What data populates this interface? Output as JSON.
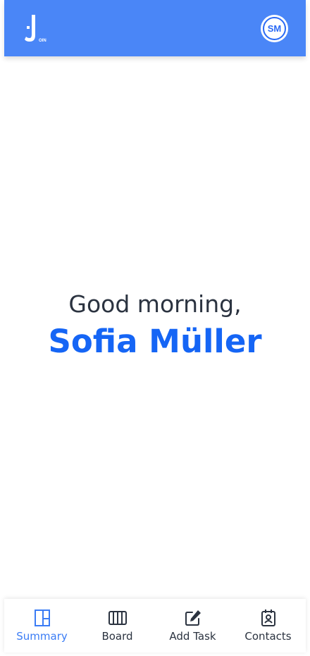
{
  "header": {
    "logo_icon": "join-logo-icon",
    "logo_subtext": "OIN",
    "avatar_initials": "SM"
  },
  "greeting": {
    "line": "Good morning,",
    "name": "Sofia Müller"
  },
  "nav": {
    "items": [
      {
        "label": "Summary",
        "icon": "summary-icon",
        "active": true
      },
      {
        "label": "Board",
        "icon": "board-icon",
        "active": false
      },
      {
        "label": "Add Task",
        "icon": "add-task-icon",
        "active": false
      },
      {
        "label": "Contacts",
        "icon": "contacts-icon",
        "active": false
      }
    ]
  },
  "colors": {
    "header_bg": "#4a86f7",
    "accent": "#1565f5",
    "active_nav": "#3a7cf5",
    "text_dark": "#2b3340"
  }
}
